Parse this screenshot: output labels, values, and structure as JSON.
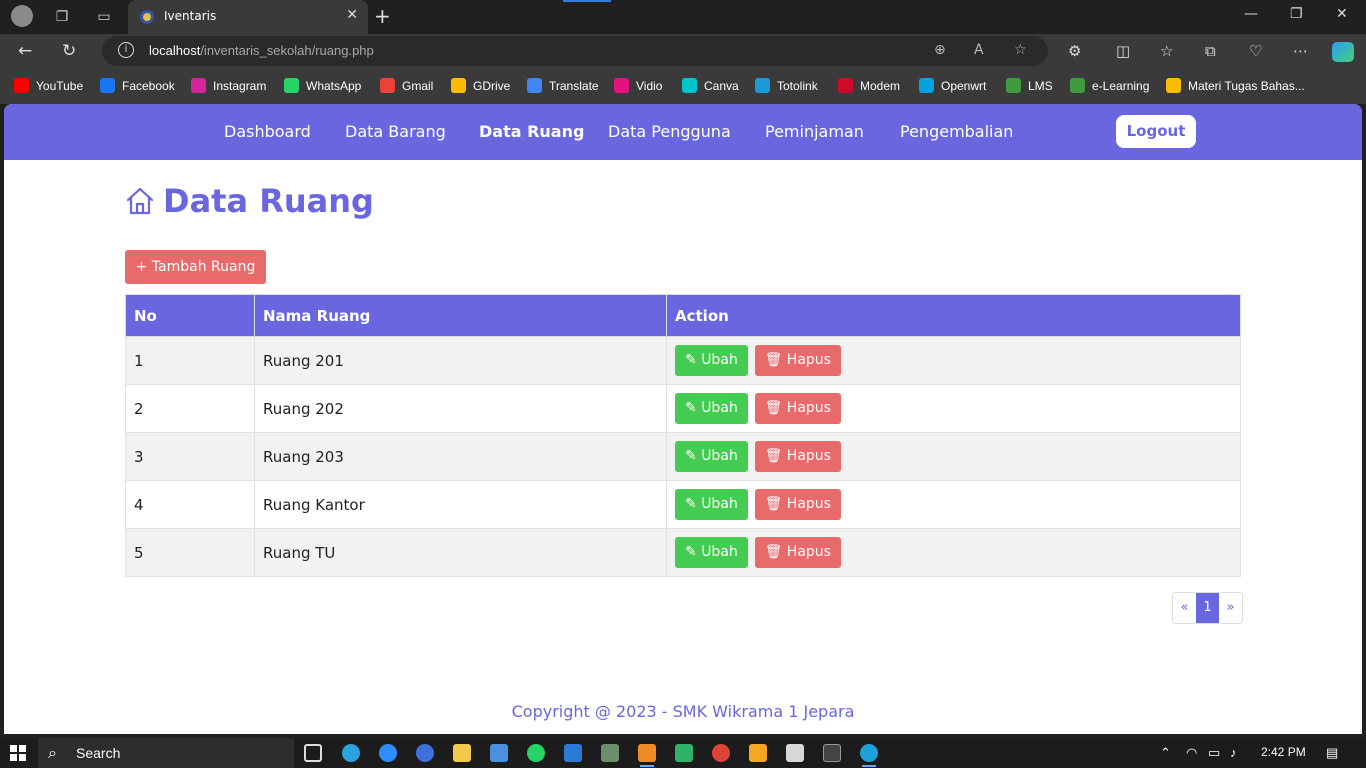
{
  "browser": {
    "tab_title": "Iventaris",
    "url_host": "localhost",
    "url_path": "/inventaris_sekolah/ruang.php"
  },
  "bookmarks": [
    {
      "label": "YouTube",
      "color": "#ff0000"
    },
    {
      "label": "Facebook",
      "color": "#1877f2"
    },
    {
      "label": "Instagram",
      "color": "#d6249f"
    },
    {
      "label": "WhatsApp",
      "color": "#25d366"
    },
    {
      "label": "Gmail",
      "color": "#ea4335"
    },
    {
      "label": "GDrive",
      "color": "#fbbc04"
    },
    {
      "label": "Translate",
      "color": "#4285f4"
    },
    {
      "label": "Vidio",
      "color": "#e5127d"
    },
    {
      "label": "Canva",
      "color": "#00c4cc"
    },
    {
      "label": "Totolink",
      "color": "#1a9bd7"
    },
    {
      "label": "Modem",
      "color": "#cf0a2c"
    },
    {
      "label": "Openwrt",
      "color": "#00a3e0"
    },
    {
      "label": "LMS",
      "color": "#3e9b3e"
    },
    {
      "label": "e-Learning",
      "color": "#3e9b3e"
    },
    {
      "label": "Materi Tugas Bahas...",
      "color": "#fbbc04"
    }
  ],
  "nav": {
    "links": [
      "Dashboard",
      "Data Barang",
      "Data Ruang",
      "Data Pengguna",
      "Peminjaman",
      "Pengembalian"
    ],
    "active": "Data Ruang",
    "logout": "Logout"
  },
  "page": {
    "title": "Data Ruang",
    "add_button": "+ Tambah Ruang"
  },
  "table": {
    "headers": [
      "No",
      "Nama Ruang",
      "Action"
    ],
    "rows": [
      {
        "no": "1",
        "name": "Ruang 201"
      },
      {
        "no": "2",
        "name": "Ruang 202"
      },
      {
        "no": "3",
        "name": "Ruang 203"
      },
      {
        "no": "4",
        "name": "Ruang Kantor"
      },
      {
        "no": "5",
        "name": "Ruang TU"
      }
    ],
    "edit_label": "Ubah",
    "delete_label": "Hapus"
  },
  "pagination": {
    "prev": "«",
    "current": "1",
    "next": "»"
  },
  "footer": "Copyright @ 2023 - SMK Wikrama 1 Jepara",
  "taskbar": {
    "search_label": "Search",
    "time": "2:42 PM"
  },
  "colors": {
    "primary": "#6a66df",
    "danger": "#e86a6a",
    "success": "#43cb52"
  }
}
